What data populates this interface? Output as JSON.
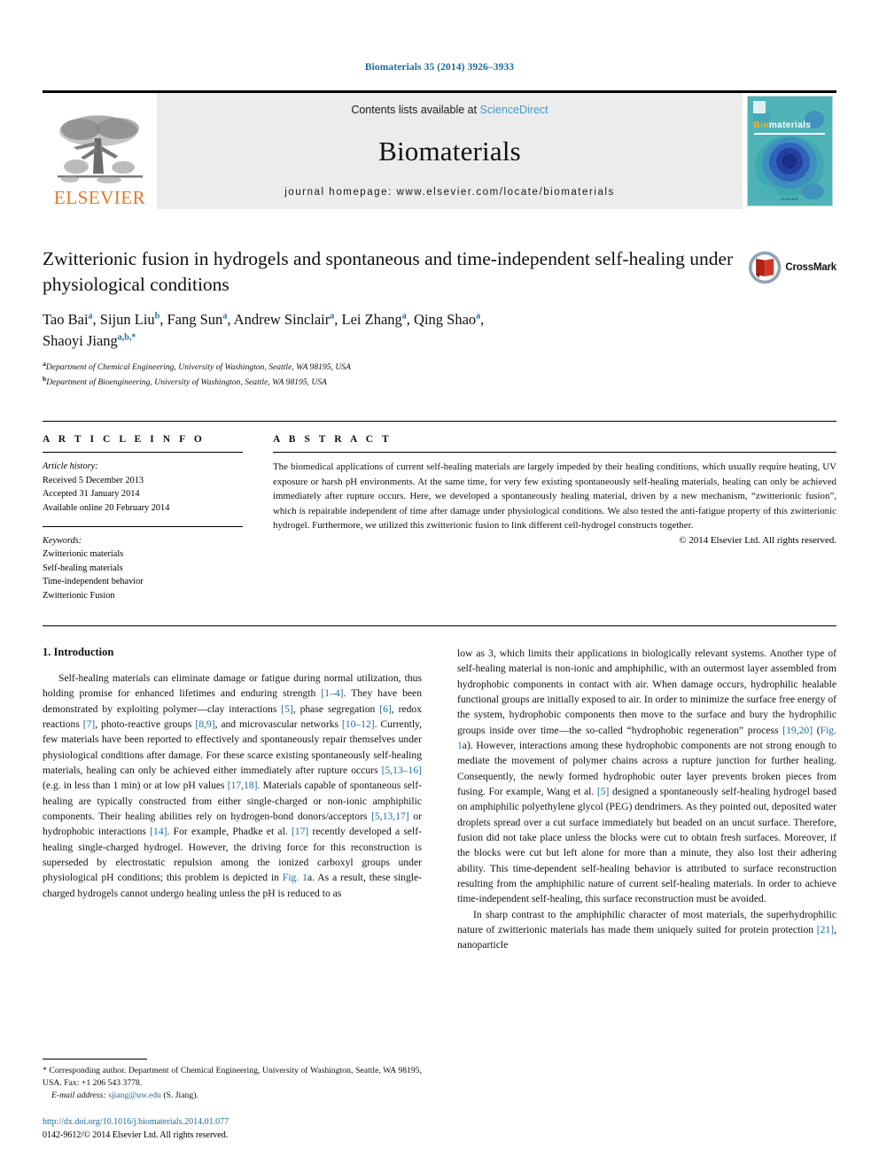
{
  "running_head": "Biomaterials 35 (2014) 3926–3933",
  "masthead": {
    "publisher_word": "ELSEVIER",
    "contents_prefix": "Contents lists available at ",
    "contents_link": "ScienceDirect",
    "journal_title": "Biomaterials",
    "homepage": "journal homepage: www.elsevier.com/locate/biomaterials",
    "cover": {
      "title_b": "Bio",
      "title_rest": "materials",
      "footer": "ELSEVIER"
    }
  },
  "article": {
    "title": "Zwitterionic fusion in hydrogels and spontaneous and time-independent self-healing under physiological conditions",
    "crossmark_label": "CrossMark",
    "authors": [
      {
        "name": "Tao Bai",
        "marks": "a"
      },
      {
        "name": "Sijun Liu",
        "marks": "b"
      },
      {
        "name": "Fang Sun",
        "marks": "a"
      },
      {
        "name": "Andrew Sinclair",
        "marks": "a"
      },
      {
        "name": "Lei Zhang",
        "marks": "a"
      },
      {
        "name": "Qing Shao",
        "marks": "a"
      },
      {
        "name": "Shaoyi Jiang",
        "marks": "a,b,*"
      }
    ],
    "affiliations": [
      {
        "mark": "a",
        "text": "Department of Chemical Engineering, University of Washington, Seattle, WA 98195, USA"
      },
      {
        "mark": "b",
        "text": "Department of Bioengineering, University of Washington, Seattle, WA 98195, USA"
      }
    ]
  },
  "article_info": {
    "heading": "A R T I C L E  I N F O",
    "history_label": "Article history:",
    "history": [
      "Received 5 December 2013",
      "Accepted 31 January 2014",
      "Available online 20 February 2014"
    ],
    "keywords_label": "Keywords:",
    "keywords": [
      "Zwitterionic materials",
      "Self-healing materials",
      "Time-independent behavior",
      "Zwitterionic Fusion"
    ]
  },
  "abstract": {
    "heading": "A B S T R A C T",
    "text": "The biomedical applications of current self-healing materials are largely impeded by their healing conditions, which usually require heating, UV exposure or harsh pH environments. At the same time, for very few existing spontaneously self-healing materials, healing can only be achieved immediately after rupture occurs. Here, we developed a spontaneously healing material, driven by a new mechanism, “zwitterionic fusion”, which is repairable independent of time after damage under physiological conditions. We also tested the anti-fatigue property of this zwitterionic hydrogel. Furthermore, we utilized this zwitterionic fusion to link different cell-hydrogel constructs together.",
    "copyright": "© 2014 Elsevier Ltd. All rights reserved."
  },
  "body": {
    "section_heading": "1. Introduction",
    "left_paragraph_1_a": "Self-healing materials can eliminate damage or fatigue during normal utilization, thus holding promise for enhanced lifetimes and enduring strength ",
    "ref_1_4": "[1–4]",
    "left_paragraph_1_b": ". They have been demonstrated by exploiting polymer—clay interactions ",
    "ref_5": "[5]",
    "left_paragraph_1_c": ", phase segregation ",
    "ref_6": "[6]",
    "left_paragraph_1_d": ", redox reactions ",
    "ref_7": "[7]",
    "left_paragraph_1_e": ", photo-reactive groups ",
    "ref_8_9": "[8,9]",
    "left_paragraph_1_f": ", and microvascular networks ",
    "ref_10_12": "[10–12]",
    "left_paragraph_1_g": ". Currently, few materials have been reported to effectively and spontaneously repair themselves under physiological conditions after damage. For these scarce existing spontaneously self-healing materials, healing can only be achieved either immediately after rupture occurs ",
    "ref_5_13_16": "[5,13–16]",
    "left_paragraph_1_h": " (e.g. in less than 1 min) or at low pH values ",
    "ref_17_18": "[17,18]",
    "left_paragraph_1_i": ". Materials capable of spontaneous self-healing are typically constructed from either single-charged or non-ionic amphiphilic components. Their healing abilities rely on hydrogen-bond donors/acceptors ",
    "ref_5_13_17": "[5,13,17]",
    "left_paragraph_1_j": " or hydrophobic interactions ",
    "ref_14": "[14]",
    "left_paragraph_1_k": ". For example, Phadke et al. ",
    "ref_17": "[17]",
    "left_paragraph_1_l": " recently developed a self-healing single-charged hydrogel. However, the driving force for this reconstruction is superseded by electrostatic repulsion among the ionized carboxyl groups under physiological pH conditions; this problem is depicted in ",
    "fig_1a_left": "Fig. 1",
    "left_paragraph_1_m": "a. As a result, these single-charged hydrogels cannot undergo healing unless the pH is reduced to as",
    "right_paragraph_1_a": "low as 3, which limits their applications in biologically relevant systems. Another type of self-healing material is non-ionic and amphiphilic, with an outermost layer assembled from hydrophobic components in contact with air. When damage occurs, hydrophilic healable functional groups are initially exposed to air. In order to minimize the surface free energy of the system, hydrophobic components then move to the surface and bury the hydrophilic groups inside over time—the so-called “hydrophobic regeneration” process ",
    "ref_19_20": "[19,20]",
    "right_paragraph_1_b": " (",
    "fig_1a_right": "Fig. 1",
    "right_paragraph_1_c": "a). However, interactions among these hydrophobic components are not strong enough to mediate the movement of polymer chains across a rupture junction for further healing. Consequently, the newly formed hydrophobic outer layer prevents broken pieces from fusing. For example, Wang et al. ",
    "ref_5_right": "[5]",
    "right_paragraph_1_d": " designed a spontaneously self-healing hydrogel based on amphiphilic polyethylene glycol (PEG) dendrimers. As they pointed out, deposited water droplets spread over a cut surface immediately but beaded on an uncut surface. Therefore, fusion did not take place unless the blocks were cut to obtain fresh surfaces. Moreover, if the blocks were cut but left alone for more than a minute, they also lost their adhering ability. This time-dependent self-healing behavior is attributed to surface reconstruction resulting from the amphiphilic nature of current self-healing materials. In order to achieve time-independent self-healing, this surface reconstruction must be avoided.",
    "right_paragraph_2_a": "In sharp contrast to the amphiphilic character of most materials, the superhydrophilic nature of zwitterionic materials has made them uniquely suited for protein protection ",
    "ref_21": "[21]",
    "right_paragraph_2_b": ", nanoparticle"
  },
  "footnotes": {
    "corresponding": "* Corresponding author. Department of Chemical Engineering, University of Washington, Seattle, WA 98195, USA. Fax: +1 206 543 3778.",
    "email_label": "E-mail address:",
    "email": "sjiang@uw.edu",
    "email_suffix": "(S. Jiang).",
    "doi": "http://dx.doi.org/10.1016/j.biomaterials.2014.01.077",
    "issn_line": "0142-9612/© 2014 Elsevier Ltd. All rights reserved."
  },
  "colors": {
    "link_blue": "#1a6ca0",
    "sciencedirect_blue": "#3f9bd0",
    "elsevier_orange": "#E87722",
    "cover_teal": "#4fb3b8"
  }
}
